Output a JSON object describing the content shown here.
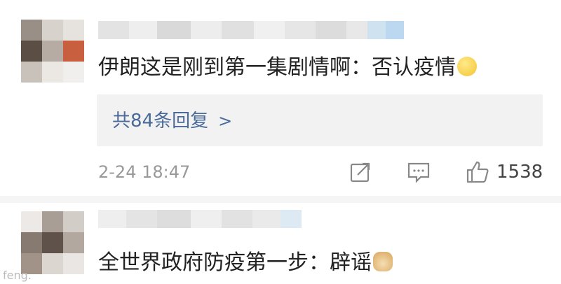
{
  "comments": [
    {
      "text": "伊朗这是刚到第一集剧情啊：否认疫情",
      "emoji": "dizzy-face-icon",
      "replies_label": "共84条回复",
      "timestamp": "2-24 18:47",
      "likes": "1538"
    },
    {
      "text": "全世界政府防疫第一步：辟谣",
      "emoji": "doge-icon"
    }
  ],
  "watermark": "feng.",
  "colors": {
    "link": "#4a6a9a",
    "meta": "#999999",
    "reply_bg": "#f2f2f2"
  }
}
